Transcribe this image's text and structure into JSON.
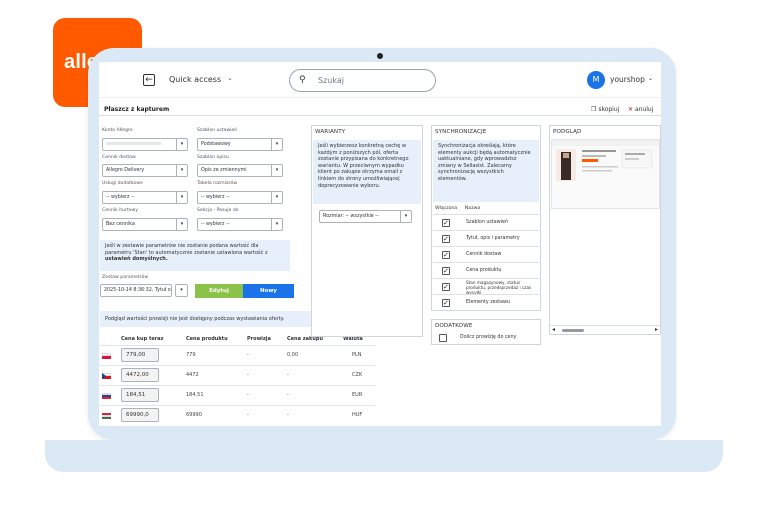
{
  "brand": {
    "logo_text": "allegro",
    "logo_color": "#ff5a00"
  },
  "topbar": {
    "back_label": "←",
    "quick_access": "Quick access",
    "search_placeholder": "Szukaj",
    "avatar_initial": "M",
    "username": "yourshop"
  },
  "page": {
    "title": "Płaszcz z kapturem",
    "copy_label": "skopiuj",
    "cancel_label": "anuluj"
  },
  "form": {
    "konto_label": "Konto Allegro",
    "konto_value": "",
    "szablon_label": "Szablon ustawień",
    "szablon_value": "Podstawowy",
    "cennik_dostaw_label": "Cennik dostaw",
    "cennik_dostaw_value": "Allegro Delivery",
    "szablon_opisu_label": "Szablon opisu",
    "szablon_opisu_value": "Opis ze zmiennymi",
    "uslugi_label": "Usługi dodatkowe",
    "uslugi_value": "-- wybierz --",
    "tabela_label": "Tabela rozmiarów",
    "tabela_value": "-- wybierz --",
    "cennik_hurtowy_label": "Cennik hurtowy",
    "cennik_hurtowy_value": "Bez cennika",
    "sekcja_label": "Sekcja - Pasuje do",
    "sekcja_value": "-- wybierz --",
    "info_text_1": "Jeśli w zestawie parametrów nie zostanie podana wartość dla parametru 'Stan' to automatycznie zostanie ustawiona wartość z",
    "info_text_bold": "ustawień domyślnych.",
    "zestaw_label": "Zestaw parametrów",
    "zestaw_value": "2025-10-14 8:36:32, Tytuł o",
    "edit_label": "Edytuj",
    "new_label": "Nowy",
    "commission_note": "Podgląd wartości prowizji nie jest dostępny podczas wystawiania oferty."
  },
  "warianty": {
    "title": "WARIANTY",
    "text": "Jeśli wybierzesz konkretną cechę w każdym z poniższych pól, oferta zostanie przypisana do konkretnego wariantu. W przeciwnym wypadku klient po zakupie otrzyma email z linkiem do strony umożliwiającej doprecyzowanie wyboru.",
    "select_value": "Rozmiar: -- wszystkie --"
  },
  "sync": {
    "title": "SYNCHRONIZACJE",
    "text": "Synchronizacja określają, które elementy aukcji będą automatycznie uaktualniane, gdy wprowadzisz zmiany w Sellasist. Zalecamy synchronizację wszystkich elementów.",
    "col_on": "Włączona",
    "col_name": "Nazwa",
    "items": [
      {
        "label": "Szablon ustawień",
        "checked": true
      },
      {
        "label": "Tytuł, opis i parametry",
        "checked": true
      },
      {
        "label": "Cennik dostaw",
        "checked": true
      },
      {
        "label": "Cena produktu",
        "checked": true
      },
      {
        "label": "Stan magazynowy, status produktu, przedsprzedaż i czas wysyłki",
        "checked": true
      },
      {
        "label": "Elementy zestawu",
        "checked": true
      }
    ]
  },
  "dodatkowe": {
    "title": "DODATKOWE",
    "item_label": "Dolicz prowizję do ceny",
    "checked": false
  },
  "podglad": {
    "title": "PODGLĄD"
  },
  "pricing": {
    "headers": [
      "Cena kup teraz",
      "Cena produktu",
      "Prowizja",
      "Cena zakupu",
      "Waluta"
    ],
    "rows": [
      {
        "flag": "pl",
        "kup_teraz": "779,00",
        "produktu": "779",
        "prowizja": "-",
        "zakupu": "0,00",
        "waluta": "PLN"
      },
      {
        "flag": "cz",
        "kup_teraz": "4472,00",
        "produktu": "4472",
        "prowizja": "-",
        "zakupu": "-",
        "waluta": "CZK"
      },
      {
        "flag": "sk",
        "kup_teraz": "184,51",
        "produktu": "184,51",
        "prowizja": "-",
        "zakupu": "-",
        "waluta": "EUR"
      },
      {
        "flag": "hu",
        "kup_teraz": "69990,0",
        "produktu": "69990",
        "prowizja": "-",
        "zakupu": "-",
        "waluta": "HUF"
      }
    ]
  },
  "colors": {
    "accent_green": "#8bc34a",
    "accent_blue": "#1a73e8",
    "info_bg": "#e7effa"
  }
}
